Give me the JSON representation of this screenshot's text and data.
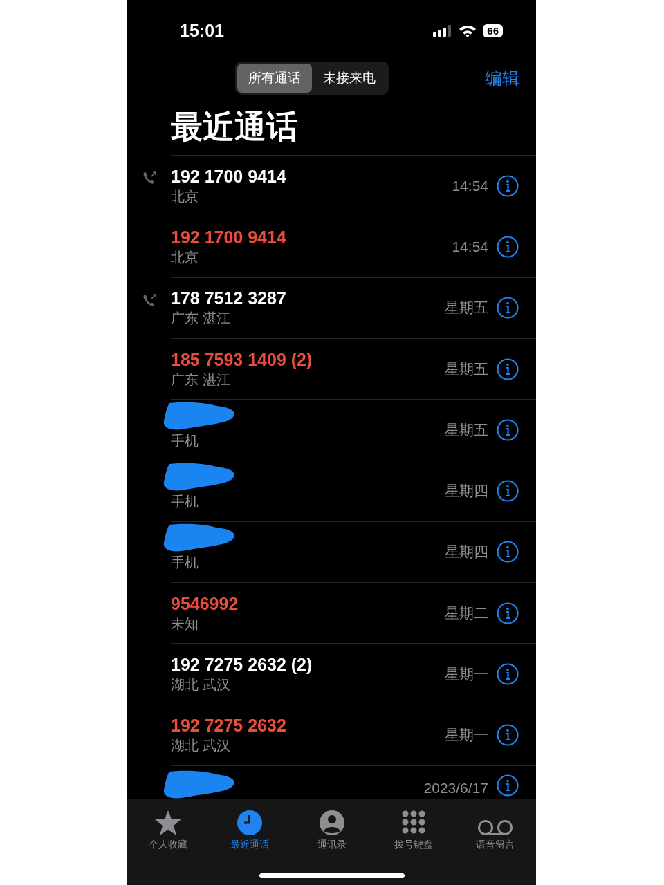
{
  "status_bar": {
    "time": "15:01",
    "battery": "66"
  },
  "segmented": [
    {
      "label": "所有通话",
      "selected": true
    },
    {
      "label": "未接来电",
      "selected": false
    }
  ],
  "edit_button": "编辑",
  "title": "最近通话",
  "calls": [
    {
      "kind": "number",
      "name": "192 1700 9414",
      "missed": false,
      "outgoing": true,
      "subtitle": "北京",
      "time": "14:54"
    },
    {
      "kind": "number",
      "name": "192 1700 9414",
      "missed": true,
      "outgoing": false,
      "subtitle": "北京",
      "time": "14:54"
    },
    {
      "kind": "number",
      "name": "178 7512 3287",
      "missed": false,
      "outgoing": true,
      "subtitle": "广东 湛江",
      "time": "星期五"
    },
    {
      "kind": "number",
      "name": "185 7593 1409 (2)",
      "missed": true,
      "outgoing": false,
      "subtitle": "广东 湛江",
      "time": "星期五"
    },
    {
      "kind": "redacted",
      "subtitle": "手机",
      "time": "星期五"
    },
    {
      "kind": "redacted",
      "subtitle": "手机",
      "time": "星期四"
    },
    {
      "kind": "redacted",
      "subtitle": "手机",
      "time": "星期四"
    },
    {
      "kind": "number",
      "name": "9546992",
      "missed": true,
      "outgoing": false,
      "subtitle": "未知",
      "time": "星期二"
    },
    {
      "kind": "number",
      "name": "192 7275 2632 (2)",
      "missed": false,
      "outgoing": false,
      "subtitle": "湖北 武汉",
      "time": "星期一"
    },
    {
      "kind": "number",
      "name": "192 7275 2632",
      "missed": true,
      "outgoing": false,
      "subtitle": "湖北 武汉",
      "time": "星期一"
    },
    {
      "kind": "redacted",
      "time": "2023/6/17"
    }
  ],
  "tab_bar": [
    {
      "kind": "star",
      "label": "个人收藏",
      "selected": false
    },
    {
      "kind": "clock",
      "label": "最近通话",
      "selected": true
    },
    {
      "kind": "person",
      "label": "通讯录",
      "selected": false
    },
    {
      "kind": "keypad",
      "label": "拨号键盘",
      "selected": false
    },
    {
      "kind": "voicemail",
      "label": "语音留言",
      "selected": false
    }
  ]
}
